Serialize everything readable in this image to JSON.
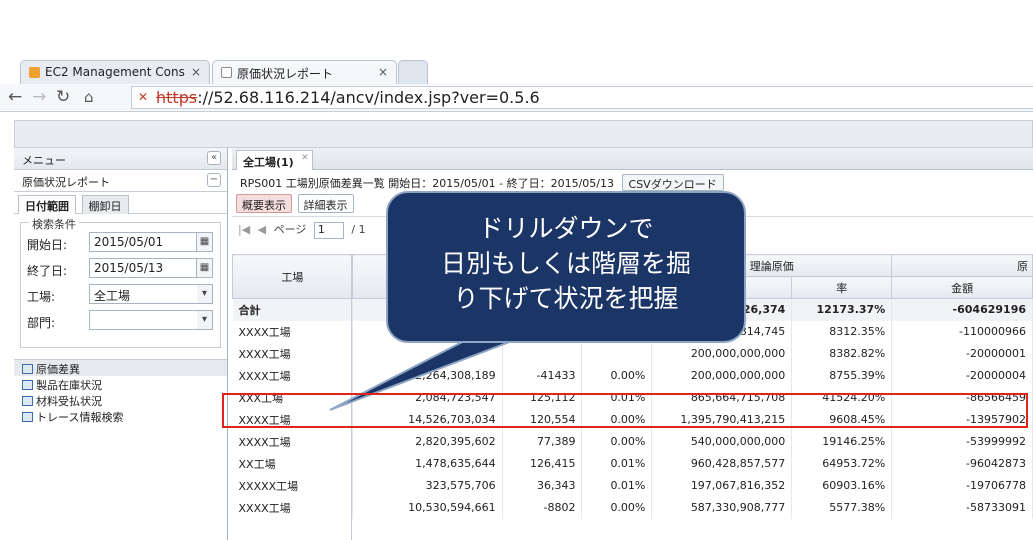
{
  "browser": {
    "tabs": [
      {
        "title": "EC2 Management Cons",
        "color": "#f0a030"
      },
      {
        "title": "原価状況レポート",
        "color": "#ffffff"
      }
    ],
    "url_protocol": "https",
    "url_rest": "://52.68.116.214/ancv/index.jsp?ver=0.5.6"
  },
  "menu": {
    "header": "メニュー",
    "report_title": "原価状況レポート",
    "subtabs": [
      "日付範囲",
      "棚卸日"
    ],
    "search_legend": "検索条件",
    "fields": [
      {
        "label": "開始日:",
        "value": "2015/05/01"
      },
      {
        "label": "終了日:",
        "value": "2015/05/13"
      },
      {
        "label": "工場:",
        "value": "全工場"
      },
      {
        "label": "部門:",
        "value": ""
      }
    ],
    "items": [
      "原価差異",
      "製品在庫状況",
      "材料受払状況",
      "トレース情報検索"
    ]
  },
  "main": {
    "tab_label": "全工場(1)",
    "info": "RPS001 工場別原価差異一覧 開始日：2015/05/01 - 終了日：2015/05/13",
    "csv_button": "CSVダウンロード",
    "view_buttons": [
      "概要表示",
      "詳細表示"
    ],
    "page_label": "ページ",
    "page_value": "1",
    "page_total": "/ 1",
    "headers": {
      "factory": "工場",
      "theory_cost": "理論原価",
      "amount": "金額",
      "rate": "率",
      "last_group": "原",
      "last_amount": "金額"
    },
    "rows": [
      {
        "name": "合計",
        "c1": "",
        "c2": "",
        "c3": "",
        "c4": "292,526,374",
        "c5": "12173.37%",
        "c6": "-604629196",
        "total": true
      },
      {
        "name": "XXXX工場",
        "c1": "",
        "c2": "",
        "c3": "",
        "c4": "0,009,814,745",
        "c5": "8312.35%",
        "c6": "-110000966"
      },
      {
        "name": "XXXX工場",
        "c1": "",
        "c2": "",
        "c3": "",
        "c4": "200,000,000,000",
        "c5": "8382.82%",
        "c6": "-20000001"
      },
      {
        "name": "XXXX工場",
        "c1": "2,264,308,189",
        "c2": "-41433",
        "c3": "0.00%",
        "c4": "200,000,000,000",
        "c5": "8755.39%",
        "c6": "-20000004"
      },
      {
        "name": "XXX工場",
        "c1": "2,084,723,547",
        "c2": "125,112",
        "c3": "0.01%",
        "c4": "865,664,715,708",
        "c5": "41524.20%",
        "c6": "-86566459"
      },
      {
        "name": "XXXX工場",
        "c1": "14,526,703,034",
        "c2": "120,554",
        "c3": "0.00%",
        "c4": "1,395,790,413,215",
        "c5": "9608.45%",
        "c6": "-13957902"
      },
      {
        "name": "XXXX工場",
        "c1": "2,820,395,602",
        "c2": "77,389",
        "c3": "0.00%",
        "c4": "540,000,000,000",
        "c5": "19146.25%",
        "c6": "-53999992"
      },
      {
        "name": "XX工場",
        "c1": "1,478,635,644",
        "c2": "126,415",
        "c3": "0.01%",
        "c4": "960,428,857,577",
        "c5": "64953.72%",
        "c6": "-96042873"
      },
      {
        "name": "XXXXX工場",
        "c1": "323,575,706",
        "c2": "36,343",
        "c3": "0.01%",
        "c4": "197,067,816,352",
        "c5": "60903.16%",
        "c6": "-19706778"
      },
      {
        "name": "XXXX工場",
        "c1": "10,530,594,661",
        "c2": "-8802",
        "c3": "0.00%",
        "c4": "587,330,908,777",
        "c5": "5577.38%",
        "c6": "-58733091"
      }
    ]
  },
  "callout": {
    "lines": [
      "ドリルダウンで",
      "日別もしくは階層を掘",
      "り下げて状況を把握"
    ]
  }
}
